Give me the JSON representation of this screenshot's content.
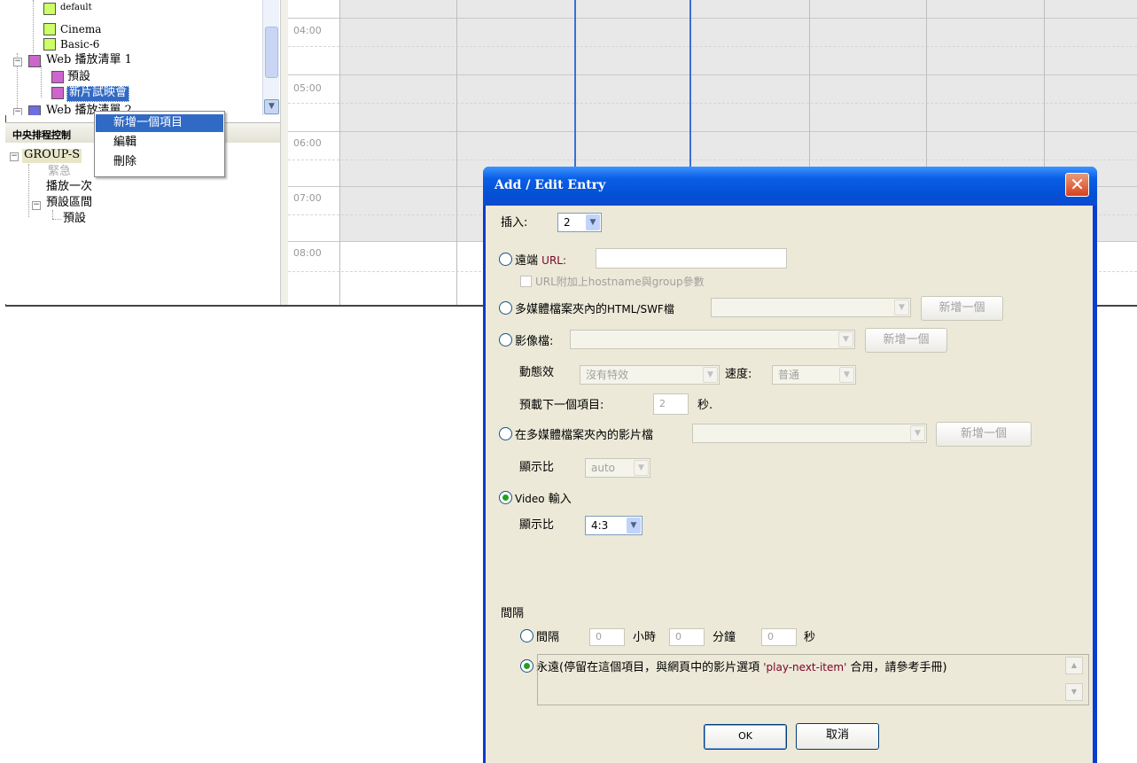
{
  "tree": {
    "items": [
      {
        "label": "default"
      },
      {
        "label": "Cinema"
      },
      {
        "label": "Basic-6"
      },
      {
        "label": "Web 播放清單 1"
      },
      {
        "label": "預設"
      },
      {
        "label": "新片試映會"
      },
      {
        "label": "Web 播放清單 2"
      }
    ]
  },
  "central": {
    "header": "中央排程控制",
    "items": [
      "GROUP-S",
      "緊急",
      "播放一次",
      "預設區間",
      "預設"
    ]
  },
  "context_menu": {
    "items": [
      "新增一個項目",
      "編輯",
      "刪除"
    ]
  },
  "schedule": {
    "times": [
      "04:00",
      "05:00",
      "06:00",
      "07:00",
      "08:00"
    ]
  },
  "dialog": {
    "title": "Add / Edit Entry",
    "close_glyph": "✕",
    "insert_label": "插入:",
    "insert_value": "2",
    "remote_label": "遠端",
    "remote_url_suffix": "URL:",
    "remote_url_value": "",
    "append_hostname_label": "URL附加上hostname與group參數",
    "html_swf_label_prefix": "多媒體檔案夾內的",
    "html_swf_label_suffix": "HTML/SWF檔",
    "html_swf_value": "",
    "add_one_label": "新增一個",
    "image_label": "影像檔:",
    "image_value": "",
    "effect_label": "動態效",
    "effect_value": "沒有特效",
    "speed_label": "速度:",
    "speed_value": "普通",
    "preload_label": "預載下一個項目:",
    "preload_value": "2",
    "preload_unit": "秒.",
    "video_file_label": "在多媒體檔案夾內的影片檔",
    "video_file_value": "",
    "aspect_label": "顯示比",
    "aspect_auto_value": "auto",
    "video_input_label_a": "Video",
    "video_input_label_b": " 輸入",
    "aspect_video_value": "4:3",
    "interval_section": "間隔",
    "interval_label": "間隔",
    "hours_value": "0",
    "hours_label": "小時",
    "minutes_value": "0",
    "minutes_label": "分鐘",
    "seconds_value": "0",
    "seconds_label": "秒",
    "forever_prefix": "永遠(停留在這個項目，與網頁中的影片選項 ",
    "forever_quote": "'play-next-item'",
    "forever_suffix": " 合用，請參考手冊)",
    "ok_label": "OK",
    "cancel_label": "取消"
  },
  "colors": {
    "title_bar": "#0a5fe6",
    "dialog_bg": "#ece9d8",
    "menu_highlight": "#316ac5",
    "schedule_marker": "#3a6fd8"
  }
}
